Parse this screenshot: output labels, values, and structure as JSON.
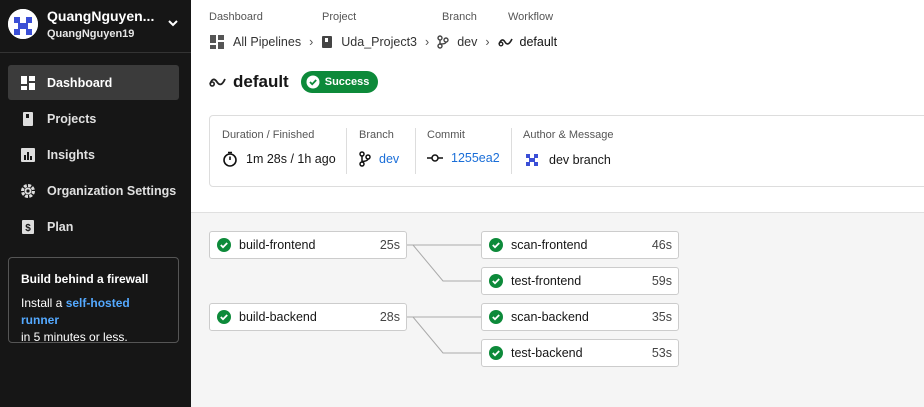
{
  "sidebar": {
    "org_name": "QuangNguyen...",
    "org_user": "QuangNguyen19",
    "items": [
      {
        "label": "Dashboard",
        "icon": "dashboard-icon",
        "active": true
      },
      {
        "label": "Projects",
        "icon": "book-icon"
      },
      {
        "label": "Insights",
        "icon": "chart-icon"
      },
      {
        "label": "Organization Settings",
        "icon": "gear-icon"
      },
      {
        "label": "Plan",
        "icon": "dollar-icon"
      }
    ],
    "promo": {
      "title": "Build behind a firewall",
      "text_before": "Install a ",
      "link": "self-hosted runner",
      "text_after": "in 5 minutes or less."
    }
  },
  "breadcrumb": {
    "labels": {
      "dashboard": "Dashboard",
      "project": "Project",
      "branch": "Branch",
      "workflow": "Workflow"
    },
    "values": {
      "dashboard": "All Pipelines",
      "project": "Uda_Project3",
      "branch": "dev",
      "workflow": "default"
    }
  },
  "workflow": {
    "name": "default",
    "status": "Success",
    "status_color": "#0d8a3a"
  },
  "info": {
    "duration_label": "Duration / Finished",
    "duration_value": "1m 28s / 1h ago",
    "branch_label": "Branch",
    "branch_value": "dev",
    "commit_label": "Commit",
    "commit_value": "1255ea2",
    "author_label": "Author & Message",
    "author_value": "dev branch"
  },
  "jobs": [
    {
      "name": "build-frontend",
      "duration": "25s"
    },
    {
      "name": "build-backend",
      "duration": "28s"
    },
    {
      "name": "scan-frontend",
      "duration": "46s"
    },
    {
      "name": "test-frontend",
      "duration": "59s"
    },
    {
      "name": "scan-backend",
      "duration": "35s"
    },
    {
      "name": "test-backend",
      "duration": "53s"
    }
  ]
}
